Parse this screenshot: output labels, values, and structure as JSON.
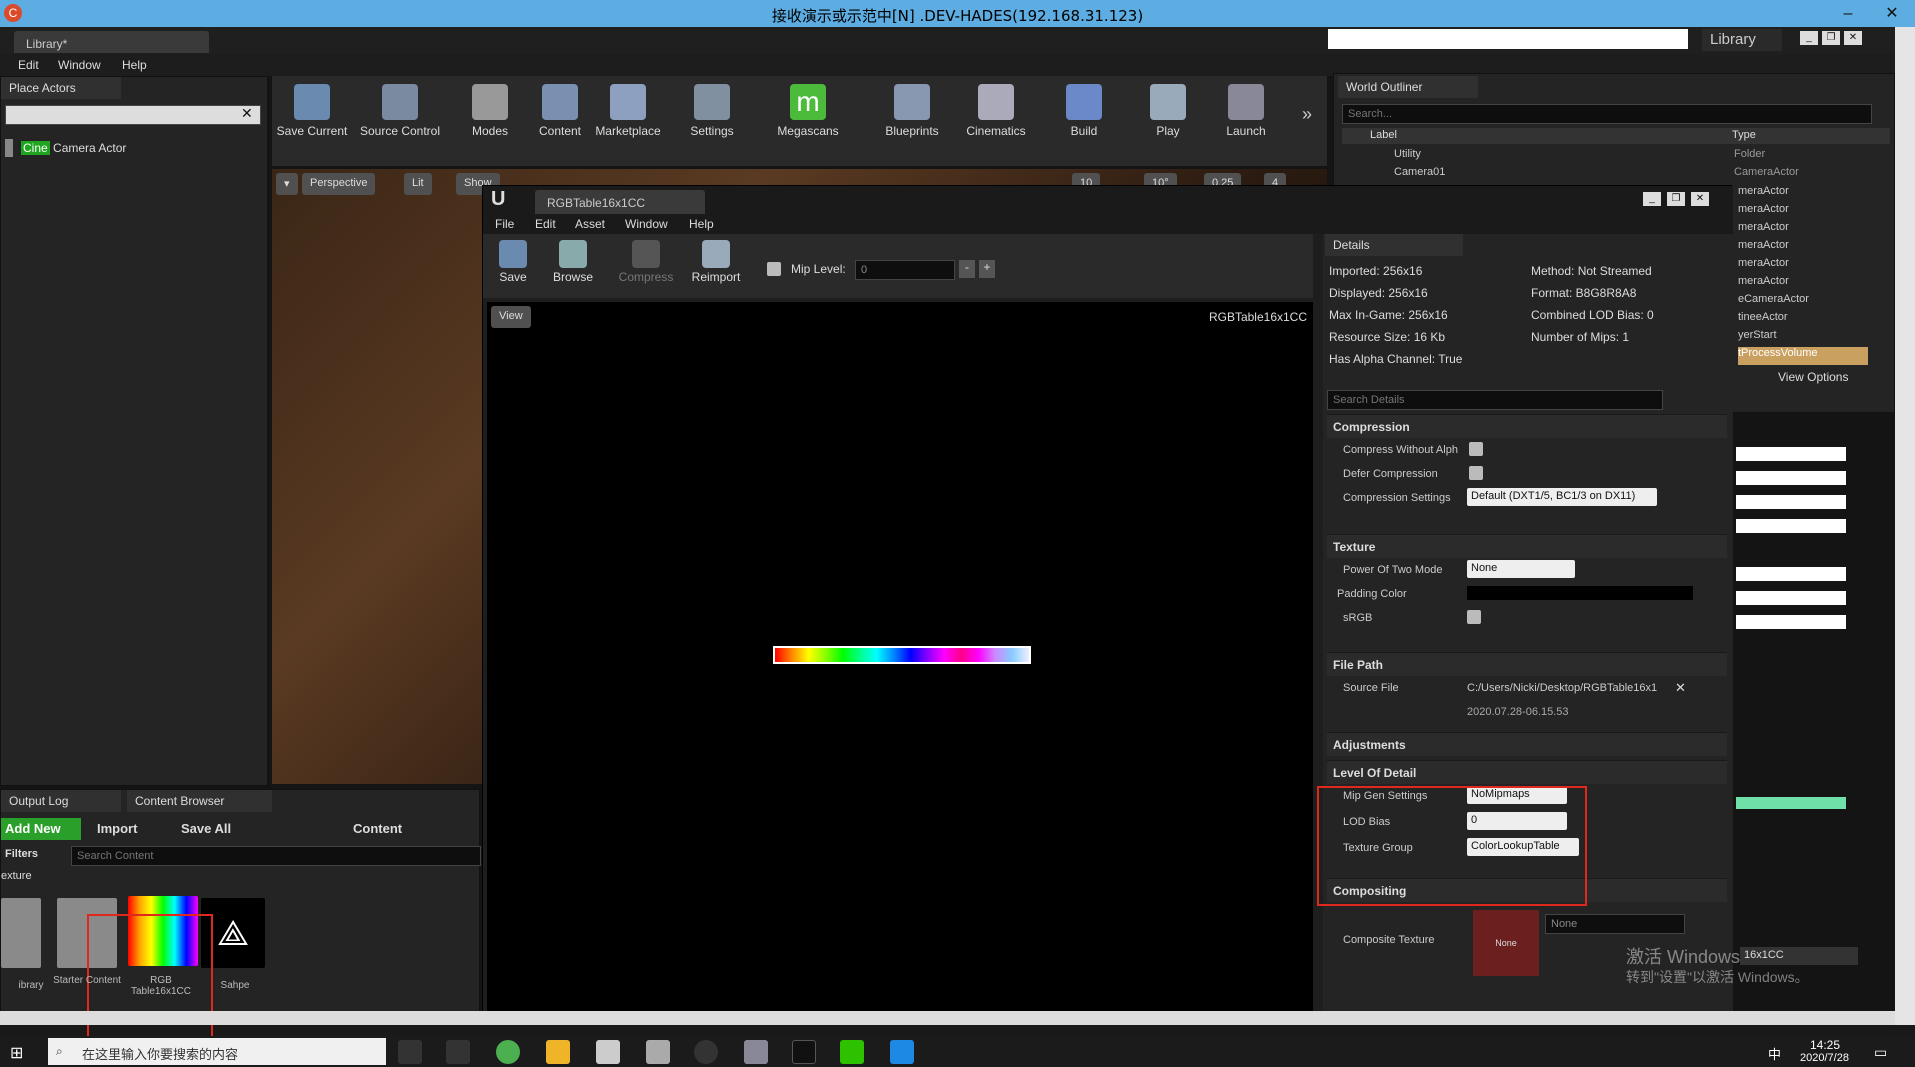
{
  "rdp": {
    "title": "接收演示或示范中[N] .DEV-HADES(192.168.31.123)"
  },
  "ue": {
    "level_tab": "Library*",
    "project_name": "Library",
    "menu": [
      "Edit",
      "Window",
      "Help"
    ],
    "place_actors": {
      "tab": "Place Actors",
      "search_value": "",
      "item_highlight": "Cine",
      "item_rest": " Camera Actor"
    },
    "toolbar": [
      "Save Current",
      "Source Control",
      "Modes",
      "Content",
      "Marketplace",
      "Settings",
      "Megascans",
      "Blueprints",
      "Cinematics",
      "Build",
      "Play",
      "Launch"
    ],
    "viewport": {
      "perspective": "Perspective",
      "lit": "Lit",
      "show": "Show",
      "grid": "10",
      "angle": "10°",
      "scale": "0.25",
      "speed": "4"
    },
    "outliner": {
      "title": "World Outliner",
      "search_placeholder": "Search...",
      "col_label": "Label",
      "col_type": "Type",
      "rows": [
        {
          "label": "Utility",
          "type": "Folder"
        },
        {
          "label": "Camera01",
          "type": "CameraActor"
        }
      ],
      "types_tail": [
        "meraActor",
        "meraActor",
        "meraActor",
        "meraActor",
        "meraActor",
        "meraActor",
        "eCameraActor",
        "tineeActor",
        "yerStart",
        "tProcessVolume"
      ],
      "view_options": "View Options"
    },
    "bottom": {
      "tab_output": "Output Log",
      "tab_cb": "Content Browser",
      "add_new": "Add New",
      "import": "Import",
      "save_all": "Save All",
      "path": "Content",
      "filters": "Filters",
      "search_placeholder": "Search Content",
      "folder_label": "exture",
      "assets": [
        {
          "name": "ibrary"
        },
        {
          "name": "Starter Content"
        },
        {
          "name": "RGB Table16x1CC"
        },
        {
          "name": "Sahpe"
        }
      ]
    }
  },
  "tex": {
    "tab": "RGBTable16x1CC",
    "menu": [
      "File",
      "Edit",
      "Asset",
      "Window",
      "Help"
    ],
    "toolbar": [
      "Save",
      "Browse",
      "Compress",
      "Reimport"
    ],
    "mip_label": "Mip Level:",
    "mip_value": "0",
    "view_btn": "View",
    "name": "RGBTable16x1CC",
    "details_tab": "Details",
    "info_left": [
      "Imported: 256x16",
      "Displayed: 256x16",
      "Max In-Game: 256x16",
      "Resource Size: 16 Kb",
      "Has Alpha Channel: True"
    ],
    "info_right": [
      "Method: Not Streamed",
      "Format: B8G8R8A8",
      "Combined LOD Bias: 0",
      "Number of Mips: 1"
    ],
    "search_placeholder": "Search Details",
    "compression": {
      "title": "Compression",
      "without_alpha": "Compress Without Alph",
      "defer": "Defer Compression",
      "settings_label": "Compression Settings",
      "settings_value": "Default (DXT1/5, BC1/3 on DX11)"
    },
    "texture": {
      "title": "Texture",
      "p2_label": "Power Of Two Mode",
      "p2_value": "None",
      "padding": "Padding Color",
      "srgb": "sRGB"
    },
    "filepath": {
      "title": "File Path",
      "source_label": "Source File",
      "source_value": "C:/Users/Nicki/Desktop/RGBTable16x1",
      "date": "2020.07.28-06.15.53"
    },
    "adjustments": "Adjustments",
    "lod": {
      "title": "Level Of Detail",
      "mip_label": "Mip Gen Settings",
      "mip_value": "NoMipmaps",
      "bias_label": "LOD Bias",
      "bias_value": "0",
      "group_label": "Texture Group",
      "group_value": "ColorLookupTable"
    },
    "compositing": {
      "title": "Compositing",
      "ct_label": "Composite Texture",
      "thumb": "None",
      "value": "None",
      "right": "16x1CC"
    }
  },
  "watermark": {
    "line1": "激活 Windows",
    "line2": "转到\"设置\"以激活 Windows。"
  },
  "taskbar": {
    "search": "在这里输入你要搜索的内容",
    "time": "14:25",
    "date": "2020/7/28",
    "ime": "中"
  },
  "colors": {
    "accent_red": "#e0281f",
    "rdp_blue": "#5dade2",
    "outliner_select": "#c9a060"
  }
}
